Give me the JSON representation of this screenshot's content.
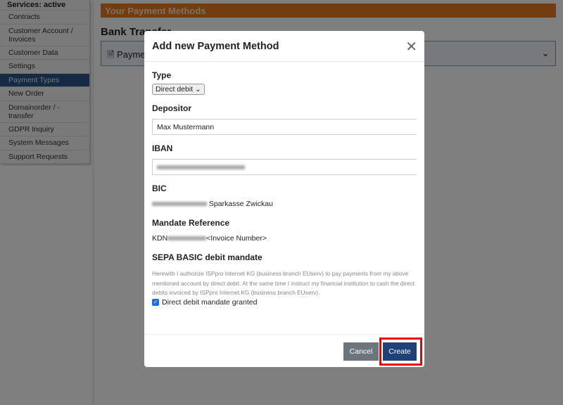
{
  "sidebar": {
    "header": "Services: active",
    "items": [
      {
        "label": "Contracts"
      },
      {
        "label": "Customer Account / Invoices"
      },
      {
        "label": "Customer Data"
      },
      {
        "label": "Settings"
      },
      {
        "label": "Payment Types",
        "active": true
      },
      {
        "label": "New Order"
      },
      {
        "label": "Domainorder / -transfer"
      },
      {
        "label": "GDPR Inquiry"
      },
      {
        "label": "System Messages"
      },
      {
        "label": "Support Requests"
      }
    ]
  },
  "main": {
    "section_title": "Your Payment Methods",
    "bank_transfer": "Bank Transfer",
    "panel_label": "Payme"
  },
  "modal": {
    "title": "Add new Payment Method",
    "type_label": "Type",
    "type_value": "Direct debit",
    "depositor_label": "Depositor",
    "depositor_value": "Max Mustermann",
    "iban_label": "IBAN",
    "bic_label": "BIC",
    "bic_bank": "Sparkasse Zwickau",
    "mandate_label": "Mandate Reference",
    "mandate_prefix": "KDN",
    "mandate_suffix": "<Invoice Number>",
    "sepa_label": "SEPA BASIC debit mandate",
    "sepa_text": "Herewith I authorize ISPpro Internet KG (business branch EUserv) to pay payments from my above mentioned account by direct debit. At the same time I instruct my financial institution to cash the direct debits invoiced by ISPpro Internet KG (business branch EUserv).",
    "checkbox_label": "Direct debit mandate granted",
    "checkbox_checked": true,
    "cancel": "Cancel",
    "create": "Create"
  },
  "colors": {
    "accent_orange": "#e87a1e",
    "primary": "#1e4178",
    "highlight": "#e00000"
  }
}
